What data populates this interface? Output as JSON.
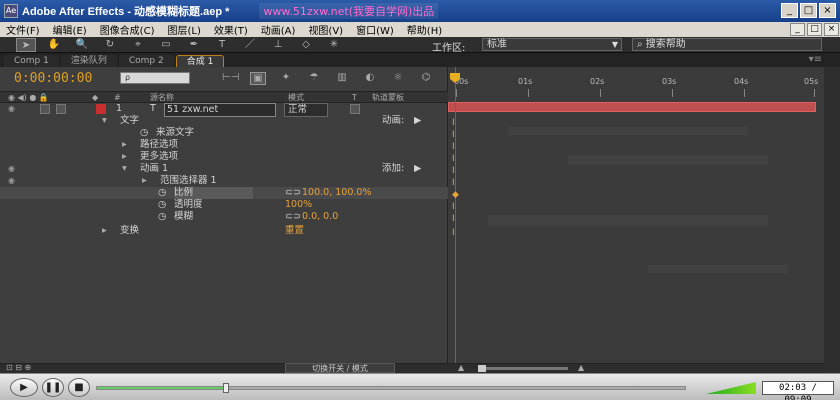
{
  "window": {
    "title": "Adobe After Effects - 动感模糊标题.aep *",
    "watermark": "www.51zxw.net(我要自学网)出品",
    "controls": [
      "_",
      "□",
      "×"
    ]
  },
  "menu": {
    "items": [
      "文件(F)",
      "编辑(E)",
      "图像合成(C)",
      "图层(L)",
      "效果(T)",
      "动画(A)",
      "视图(V)",
      "窗口(W)",
      "帮助(H)"
    ],
    "right_controls": [
      "_",
      "□",
      "×"
    ]
  },
  "toolbar": {
    "tools": [
      "select-tool",
      "hand-tool",
      "zoom-tool",
      "rotate-tool",
      "camera-tool",
      "pan-behind-tool",
      "mask-tool",
      "pen-tool",
      "text-tool",
      "brush-tool",
      "clone-tool",
      "eraser-tool",
      "puppet-tool"
    ],
    "workspace_label": "工作区:",
    "workspace_value": "标准",
    "help_search_placeholder": "搜索帮助"
  },
  "tabs": [
    "Comp 1",
    "渲染队列",
    "Comp 2",
    "合成 1"
  ],
  "timeline": {
    "timecode": "0:00:00:00",
    "search_placeholder": "ρ",
    "columns": {
      "switches": "◉ ◀) ● 🔒",
      "label": "◆",
      "num": "#",
      "source_name": "源名称",
      "mode": "模式",
      "t": "T",
      "trkmat": "轨道蒙板"
    },
    "layer": {
      "num": "1",
      "name": "51 zxw.net",
      "mode": "正常"
    },
    "rows": {
      "text": "文字",
      "animate_label": "动画:",
      "source_text": "来源文字",
      "path_options": "路径选项",
      "more_options": "更多选项",
      "animator": "动画 1",
      "add_label": "添加:",
      "range_selector": "范围选择器 1",
      "scale": "比例",
      "scale_value": "100.0, 100.0%",
      "opacity": "透明度",
      "opacity_value": "100%",
      "blur": "模糊",
      "blur_value": "0.0, 0.0",
      "transform": "变换",
      "transform_reset": "重置"
    },
    "bottom_toggle": "切换开关 / 模式",
    "ruler_labels": [
      "00s",
      "01s",
      "02s",
      "03s",
      "04s",
      "05s"
    ]
  },
  "player": {
    "time": "02:03 / 09:09",
    "progress": 0.22,
    "volume": 1.0
  }
}
